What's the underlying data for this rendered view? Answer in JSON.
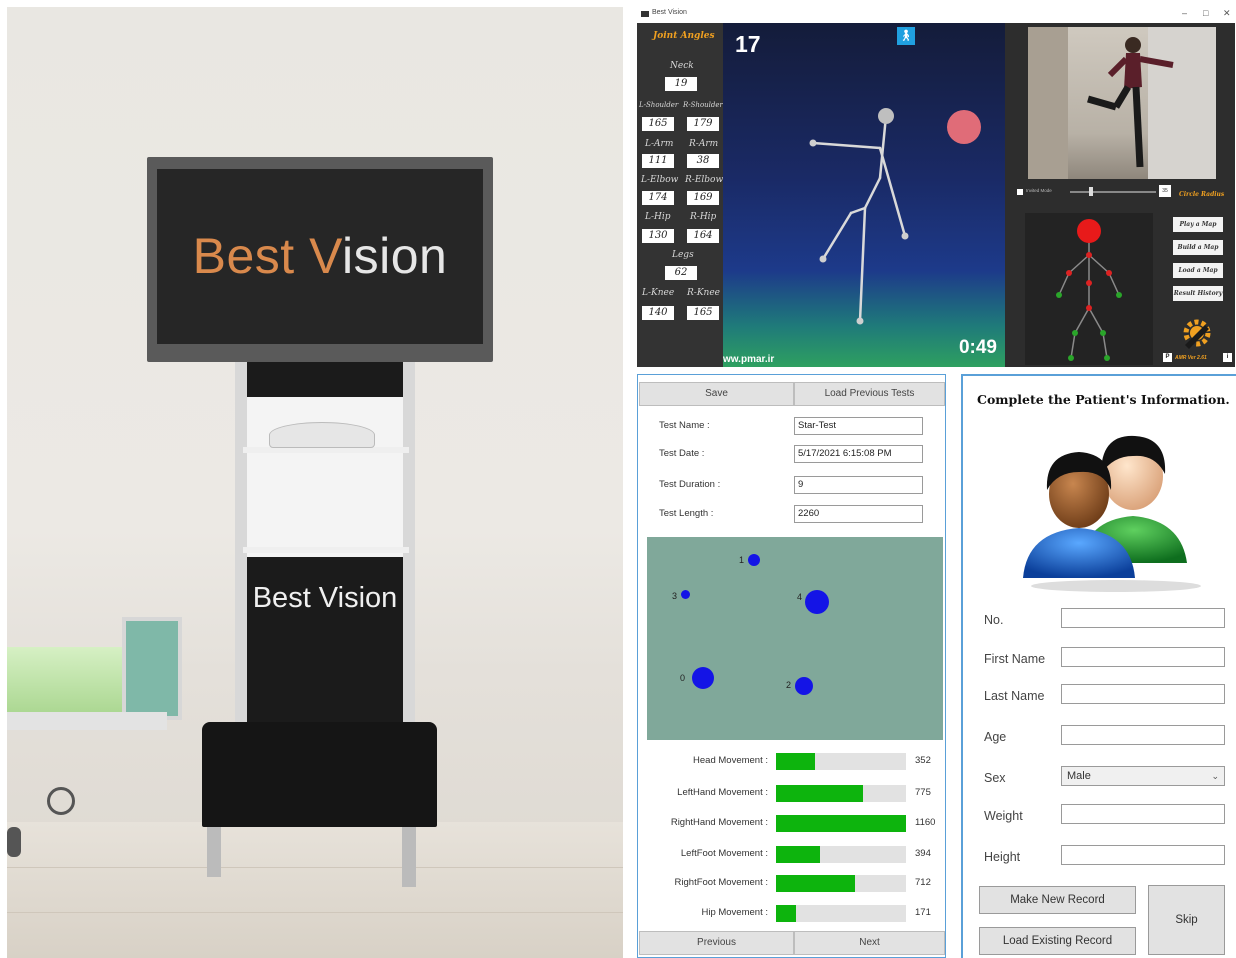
{
  "render": {
    "monitor_brand_first": "Best ",
    "monitor_brand_v": "V",
    "monitor_brand_rest": "ision",
    "cabinet_brand": "Best Vision"
  },
  "window": {
    "title": "Best Vision",
    "controls": [
      "–",
      "□",
      "✕"
    ]
  },
  "joint_angles": {
    "title": "Joint Angles",
    "neck_label": "Neck",
    "neck": "19",
    "l_shoulder_label": "L-Shoulder",
    "l_shoulder": "165",
    "r_shoulder_label": "R-Shoulder",
    "r_shoulder": "179",
    "l_arm_label": "L-Arm",
    "l_arm": "111",
    "r_arm_label": "R-Arm",
    "r_arm": "38",
    "l_elbow_label": "L-Elbow",
    "l_elbow": "174",
    "r_elbow_label": "R-Elbow",
    "r_elbow": "169",
    "l_hip_label": "L-Hip",
    "l_hip": "130",
    "r_hip_label": "R-Hip",
    "r_hip": "164",
    "legs_label": "Legs",
    "legs": "62",
    "l_knee_label": "L-Knee",
    "l_knee": "140",
    "r_knee_label": "R-Knee",
    "r_knee": "165"
  },
  "scene": {
    "count": "17",
    "timer": "0:49",
    "site": "ww.pmar.ir"
  },
  "right_panel": {
    "invited_mode": "Invited Mode",
    "slider_value": "35",
    "circle_radius": "Circle Radius",
    "buttons": [
      "Play a Map",
      "Build a Map",
      "Load a Map",
      "Result History"
    ],
    "version": "AMR Ver 2.61",
    "p_btn": "P",
    "i_btn": "i"
  },
  "test_panel": {
    "save": "Save",
    "load_previous": "Load Previous Tests",
    "test_name_label": "Test Name :",
    "test_name": "Star-Test",
    "test_date_label": "Test Date :",
    "test_date": "5/17/2021 6:15:08 PM",
    "test_duration_label": "Test Duration :",
    "test_duration": "9",
    "test_length_label": "Test Length :",
    "test_length": "2260",
    "targets": [
      {
        "label": "1",
        "size": "small"
      },
      {
        "label": "3",
        "size": "small"
      },
      {
        "label": "4",
        "size": "large"
      },
      {
        "label": "0",
        "size": "large"
      },
      {
        "label": "2",
        "size": "medium"
      }
    ],
    "movements": [
      {
        "label": "Head Movement :",
        "value": "352",
        "fraction": 0.3
      },
      {
        "label": "LeftHand Movement :",
        "value": "775",
        "fraction": 0.67
      },
      {
        "label": "RightHand Movement :",
        "value": "1160",
        "fraction": 1.0
      },
      {
        "label": "LeftFoot Movement :",
        "value": "394",
        "fraction": 0.34
      },
      {
        "label": "RightFoot Movement :",
        "value": "712",
        "fraction": 0.61
      },
      {
        "label": "Hip Movement :",
        "value": "171",
        "fraction": 0.15
      }
    ],
    "previous": "Previous",
    "next": "Next"
  },
  "patient": {
    "title": "Complete the Patient's Information.",
    "no_label": "No.",
    "no": "",
    "first_name_label": "First Name",
    "first_name": "",
    "last_name_label": "Last Name",
    "last_name": "",
    "age_label": "Age",
    "age": "",
    "sex_label": "Sex",
    "sex": "Male",
    "weight_label": "Weight",
    "weight": "",
    "height_label": "Height",
    "height": "",
    "make_new": "Make New Record",
    "load_existing": "Load Existing Record",
    "skip": "Skip"
  },
  "colors": {
    "accent_blue": "#5aa0d8",
    "bar_green": "#0db40d",
    "target_blue": "#1414e6",
    "joint_title_orange": "#f0a020"
  }
}
